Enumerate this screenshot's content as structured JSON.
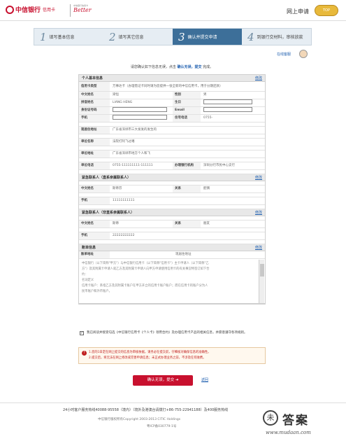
{
  "header": {
    "bank_name": "中信银行",
    "card_label": "信用卡",
    "better_top": "中信银行信用卡",
    "better_word": "Better",
    "net_apply": "网上申请",
    "badge": "TOP"
  },
  "steps": [
    {
      "num": "1",
      "label": "填写基本信息"
    },
    {
      "num": "2",
      "label": "填写其它信息"
    },
    {
      "num": "3",
      "label": "确认并提交申请"
    },
    {
      "num": "4",
      "label": "到银行交材料，审核放款"
    }
  ],
  "online_help": "在线客服",
  "notice": {
    "pre": "请您确认如下信息无误，点击",
    "bold": "确认无误，提交",
    "post": "完成。"
  },
  "modify_label": "修改",
  "sections": {
    "personal": {
      "title": "个人基本信息",
      "card_type_label": "信用卡类型",
      "card_type_value": "万事达卡（办理借记卡同时请为您提供一张全新的中信信用卡，用于分期还款）",
      "name_label": "中文姓名",
      "name_value": "梁恒",
      "sex_label": "性别",
      "sex_value": "男",
      "pinyin_label": "拼音姓名",
      "pinyin_value": "LIANG HENG",
      "birth_label": "生日",
      "id_label": "身份证号码",
      "email_label": "Email",
      "mobile_label": "手机",
      "home_tel_label": "住宅电话",
      "home_tel_value": "0755-",
      "addr_label": "现居住地址",
      "addr_value": "广东省深圳市三大发发的发生的",
      "company_label": "单位名称",
      "company_value": "法院打阿飞过噶",
      "company_addr_label": "单位地址",
      "company_addr_value": "广东省深圳市地方个人和飞",
      "company_tel_label": "单位电话",
      "company_tel_value": "0755-111111111-111111",
      "branch_label": "办理银行机构",
      "branch_value": "深圳分行市民中心支行"
    },
    "contact1": {
      "title": "紧急联系人（直系亲属联系人）",
      "name_label": "中文姓名",
      "name_value": "斯蒂芬",
      "rel_label": "关系",
      "rel_value": "配偶",
      "mobile_label": "手机",
      "mobile_value": "11111111111"
    },
    "contact2": {
      "title": "紧急联系人（非直系亲属联系人）",
      "name_label": "中文姓名",
      "name_value": "斯蒂",
      "rel_label": "关系",
      "rel_value": "朋友",
      "mobile_label": "手机",
      "mobile_value": "22222222222"
    },
    "bill": {
      "title": "账单信息",
      "addr_label": "账单地址",
      "addr_value": "现居住地址"
    }
  },
  "terms": {
    "line1": "中信银行（以下简称\"甲方\"）与中信银行信用卡（以下简称\"信用卡\"）主卡申请人（以下简称\"乙",
    "line2": "方\"）及其附属卡申请人就乙方及其附属卡申请人向甲方申请使用信用卡的有关事宜特签订如下合",
    "line3": "约：",
    "line4": "名词定义",
    "line5": "信用卡账户：系指乙方及其附属卡账户在甲方开立的信用卡账户账户；而在信用卡的账户分为人",
    "line6": "民币账户和外币账户。"
  },
  "agree_text": "我已阅读并接受勾选《中信银行信用卡《个人卡》领用合约》及办理信用卡产品的相关信息，并愿意遵守各项规则。",
  "warnings": {
    "line1": "1.您的1日定在网上提交的信息为审核依据，请务必在提交前，仔细核对确保信息的准确性。",
    "line2": "2.提交后，将无法在网上修改或完善申请信息；未正式办理业务之前，不涉及任何收费。"
  },
  "submit_label": "确认无误，提交",
  "back_label": "返回",
  "footer": {
    "line1": "24小时客户服务热线40088-95558（境内）（境外及港澳台请拨打+86-755-22941188）及400服务热线",
    "line2": "中信银行版权所有Copyright 2003-2013 CITIC Holdings",
    "line3": "粤ICP备030779-1号"
  },
  "watermark": {
    "glyph": "未",
    "text": "答案",
    "url": "www.mudaan.com"
  }
}
